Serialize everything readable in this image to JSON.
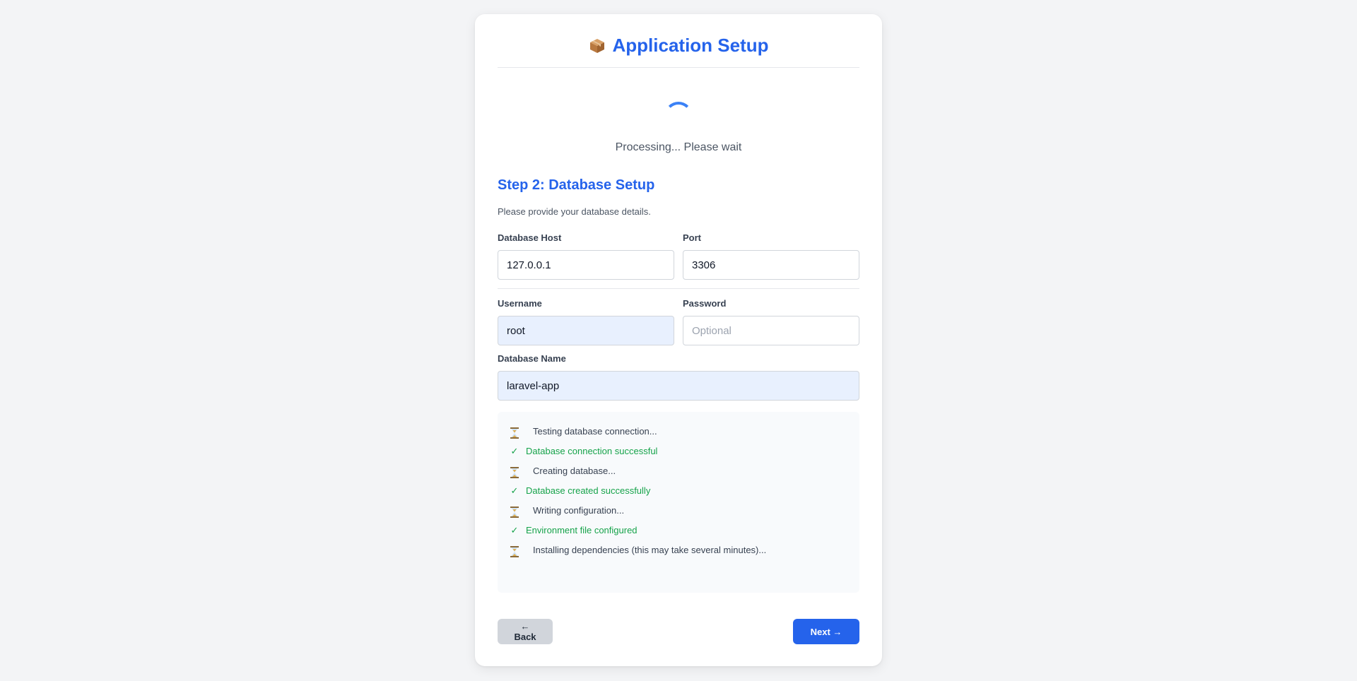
{
  "header": {
    "icon": "package-icon",
    "title": "Application Setup"
  },
  "status": {
    "processing_text": "Processing... Please wait"
  },
  "step": {
    "title": "Step 2: Database Setup",
    "description": "Please provide your database details."
  },
  "fields": {
    "db_host": {
      "label": "Database Host",
      "value": "127.0.0.1"
    },
    "port": {
      "label": "Port",
      "value": "3306"
    },
    "username": {
      "label": "Username",
      "value": "root"
    },
    "password": {
      "label": "Password",
      "value": "",
      "placeholder": "Optional"
    },
    "db_name": {
      "label": "Database Name",
      "value": "laravel-app"
    }
  },
  "log": [
    {
      "state": "pending",
      "icon": "hourglass-icon",
      "text": "Testing database connection..."
    },
    {
      "state": "success",
      "icon": "check-icon",
      "text": "Database connection successful"
    },
    {
      "state": "pending",
      "icon": "hourglass-icon",
      "text": "Creating database..."
    },
    {
      "state": "success",
      "icon": "check-icon",
      "text": "Database created successfully"
    },
    {
      "state": "pending",
      "icon": "hourglass-icon",
      "text": "Writing configuration..."
    },
    {
      "state": "success",
      "icon": "check-icon",
      "text": "Environment file configured"
    },
    {
      "state": "pending",
      "icon": "hourglass-icon",
      "text": "Installing dependencies (this may take several minutes)..."
    }
  ],
  "buttons": {
    "back": "← Back",
    "next": "Next →"
  },
  "colors": {
    "accent": "#2563eb",
    "success": "#16a34a",
    "autofill": "#e8f0fe"
  }
}
